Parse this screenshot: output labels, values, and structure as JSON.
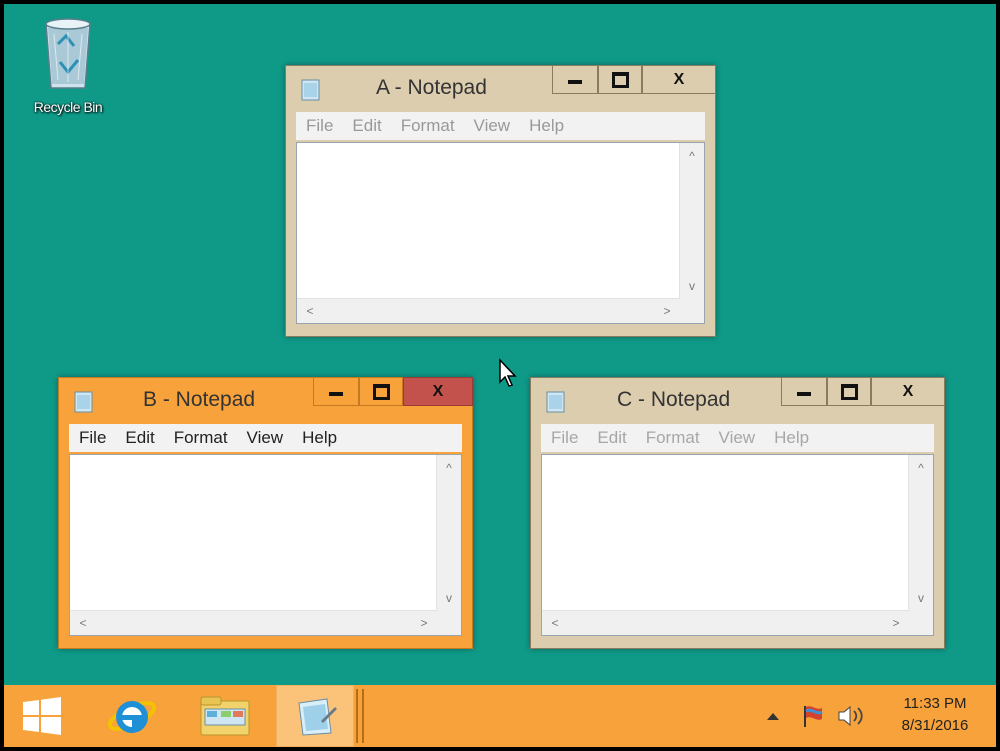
{
  "desktop": {
    "background_color": "#0f9a88",
    "recycle_bin": {
      "label": "Recycle Bin",
      "icon": "recycle-bin-icon"
    }
  },
  "windows": [
    {
      "id": "A",
      "title": "A - Notepad",
      "state": "inactive",
      "frame_color": "#dccdaf",
      "menu": [
        "File",
        "Edit",
        "Format",
        "View",
        "Help"
      ],
      "content": ""
    },
    {
      "id": "B",
      "title": "B - Notepad",
      "state": "active",
      "frame_color": "#f7a23a",
      "close_color": "#c4524c",
      "menu": [
        "File",
        "Edit",
        "Format",
        "View",
        "Help"
      ],
      "content": ""
    },
    {
      "id": "C",
      "title": "C - Notepad",
      "state": "inactive",
      "frame_color": "#dccdaf",
      "menu": [
        "File",
        "Edit",
        "Format",
        "View",
        "Help"
      ],
      "content": ""
    }
  ],
  "caption_buttons": {
    "close_glyph": "X"
  },
  "scroll_glyphs": {
    "up": "^",
    "down": "v",
    "left": "<",
    "right": ">"
  },
  "taskbar": {
    "color": "#f7a23a",
    "items": [
      "windows-logo-icon",
      "internet-explorer-icon",
      "file-explorer-icon",
      "notepad-icon"
    ],
    "tray": [
      "tray-up-arrow-icon",
      "action-center-flag-icon",
      "volume-icon"
    ],
    "clock": {
      "time": "11:33 PM",
      "date": "8/31/2016"
    }
  }
}
